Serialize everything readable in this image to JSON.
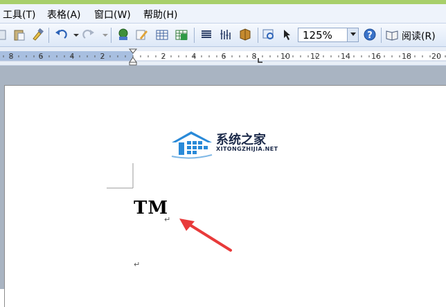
{
  "menubar": {
    "items": [
      "工具(T)",
      "表格(A)",
      "窗口(W)",
      "帮助(H)"
    ]
  },
  "toolbar": {
    "zoom_value": "125%",
    "reading_label": "阅读(R)",
    "icons": [
      "paste-icon",
      "format-painter-icon",
      "undo-icon",
      "redo-icon",
      "hyperlink-icon",
      "drawing-icon",
      "insert-table-icon",
      "insert-excel-icon",
      "columns-icon",
      "show-hide-icon",
      "document-map-icon",
      "research-icon",
      "help-icon",
      "read-icon"
    ]
  },
  "ruler": {
    "left_numbers": [
      "8",
      "6",
      "4",
      "2"
    ],
    "right_numbers": [
      "2",
      "4",
      "6",
      "8",
      "10",
      "12",
      "14",
      "16",
      "18",
      "20"
    ]
  },
  "document": {
    "text": "TM",
    "paragraph_mark": "↵"
  },
  "watermark": {
    "title": "系统之家",
    "subtitle": "XITONGZHIJIA.NET"
  },
  "colors": {
    "accent_strip": "#a8cf6a",
    "annotation_arrow": "#e83a3a",
    "logo_blue": "#2a8ad8"
  }
}
